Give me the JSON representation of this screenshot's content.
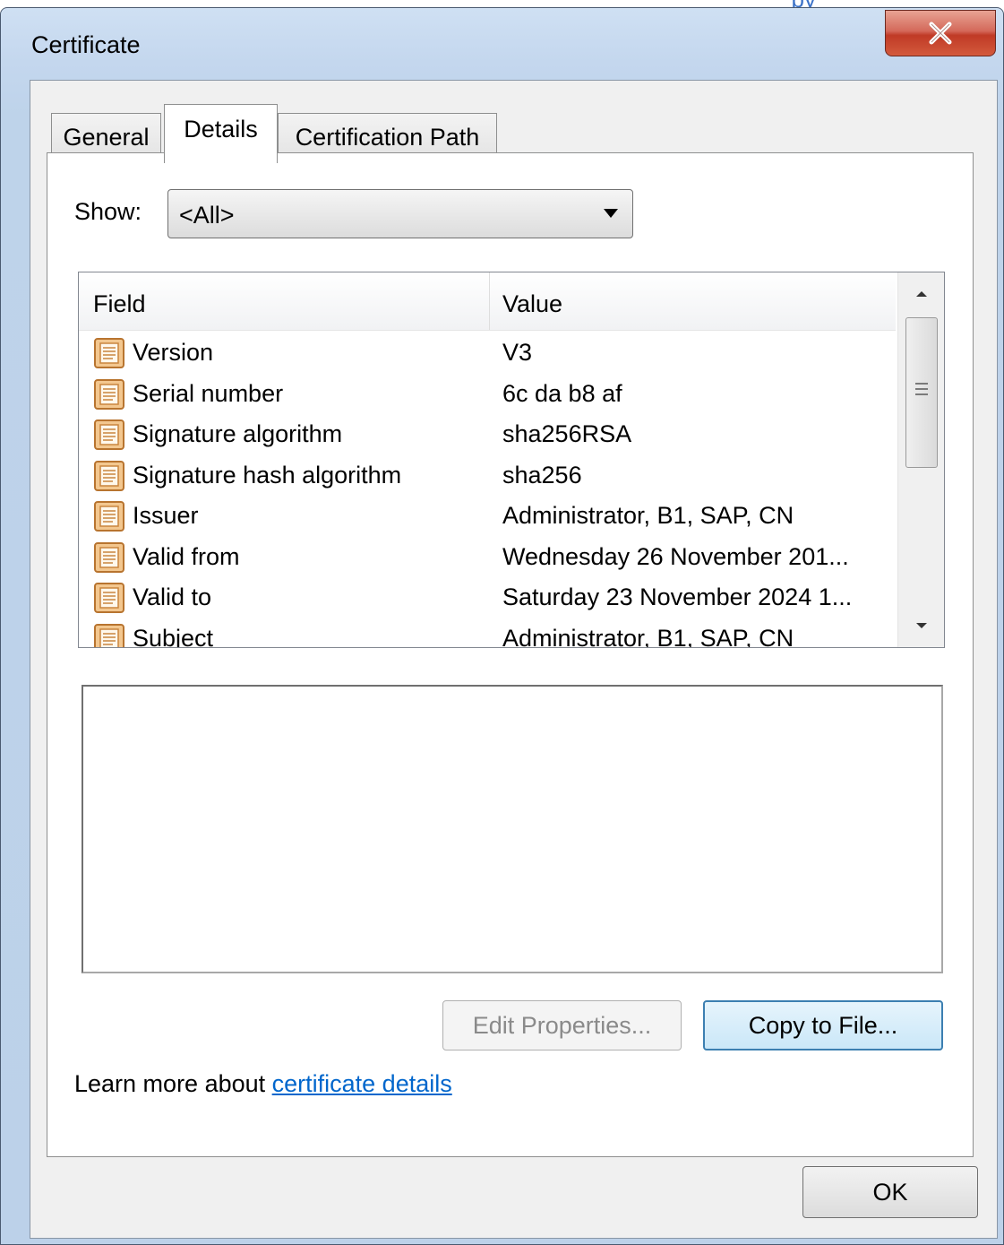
{
  "background": {
    "partial_link_text": "py"
  },
  "window": {
    "title": "Certificate"
  },
  "tabs": [
    {
      "label": "General",
      "selected": false
    },
    {
      "label": "Details",
      "selected": true
    },
    {
      "label": "Certification Path",
      "selected": false
    }
  ],
  "show": {
    "label": "Show:",
    "value": "<All>"
  },
  "list": {
    "columns": {
      "field": "Field",
      "value": "Value"
    },
    "rows": [
      {
        "field": "Version",
        "value": "V3"
      },
      {
        "field": "Serial number",
        "value": "6c da b8 af"
      },
      {
        "field": "Signature algorithm",
        "value": "sha256RSA"
      },
      {
        "field": "Signature hash algorithm",
        "value": "sha256"
      },
      {
        "field": "Issuer",
        "value": "Administrator, B1, SAP, CN"
      },
      {
        "field": "Valid from",
        "value": "Wednesday 26 November 201..."
      },
      {
        "field": "Valid to",
        "value": "Saturday 23 November 2024 1..."
      },
      {
        "field": "Subject",
        "value": "Administrator, B1, SAP, CN"
      }
    ]
  },
  "buttons": {
    "edit_properties": "Edit Properties...",
    "copy_to_file": "Copy to File...",
    "ok": "OK"
  },
  "learn_more": {
    "prefix": "Learn more about ",
    "link": "certificate details"
  },
  "colors": {
    "link": "#0066cc",
    "close_button": "#c03a26",
    "focus_border": "#3c7fb1"
  }
}
